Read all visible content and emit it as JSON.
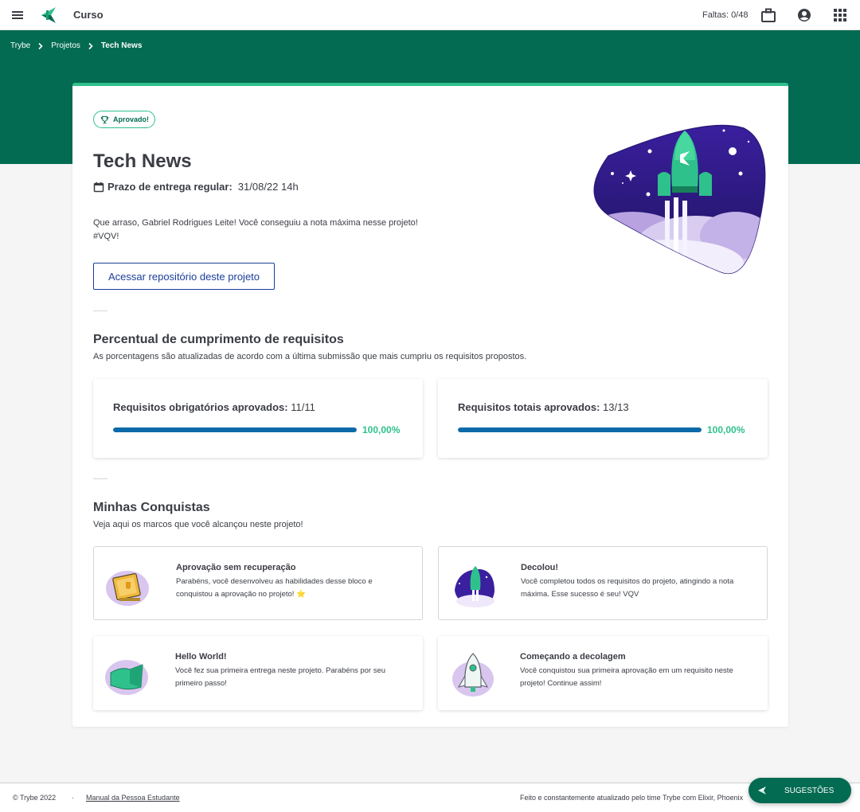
{
  "header": {
    "course_title": "Curso",
    "faltas": "Faltas: 0/48"
  },
  "breadcrumb": [
    "Trybe",
    "Projetos",
    "Tech News"
  ],
  "project": {
    "badge": "Aprovado!",
    "title": "Tech News",
    "deadline_label": "Prazo de entrega regular:",
    "deadline_value": "31/08/22 14h",
    "congrats_line1": "Que arraso, Gabriel Rodrigues Leite! Você conseguiu a nota máxima nesse projeto!",
    "congrats_line2": "#VQV!",
    "repo_button": "Acessar repositório deste projeto"
  },
  "requirements": {
    "title": "Percentual de cumprimento de requisitos",
    "subtitle": "As porcentagens são atualizadas de acordo com a última submissão que mais cumpriu os requisitos propostos.",
    "boxes": [
      {
        "label": "Requisitos obrigatórios aprovados:",
        "value": "11/11",
        "percent_text": "100,00%",
        "fill": 1.0
      },
      {
        "label": "Requisitos totais aprovados:",
        "value": "13/13",
        "percent_text": "100,00%",
        "fill": 1.0
      }
    ]
  },
  "achievements": {
    "title": "Minhas Conquistas",
    "subtitle": "Veja aqui os marcos que você alcançou neste projeto!",
    "items": [
      {
        "title": "Aprovação sem recuperação",
        "desc": "Parabéns, você desenvolveu as habilidades desse bloco e conquistou a aprovação no projeto! ⭐",
        "icon": "trophy-book-icon"
      },
      {
        "title": "Decolou!",
        "desc": "Você completou todos os requisitos do projeto, atingindo a nota máxima. Esse sucesso é seu! VQV",
        "icon": "rocket-launch-icon"
      },
      {
        "title": "Hello World!",
        "desc": "Você fez sua primeira entrega neste projeto. Parabéns por seu primeiro passo!",
        "icon": "flag-icon"
      },
      {
        "title": "Começando a decolagem",
        "desc": "Você conquistou sua primeira aprovação em um requisito neste projeto! Continue assim!",
        "icon": "rocket-icon"
      }
    ]
  },
  "footer": {
    "copyright": "© Trybe 2022",
    "dot": "·",
    "manual": "Manual da Pessoa Estudante",
    "made_by": "Feito e constantemente atualizado pelo time Trybe com Elixir, Phoenix",
    "suggest": "SUGESTÕES"
  },
  "colors": {
    "brand_green": "#036b52",
    "accent_green": "#2fc18c",
    "bar_blue": "#0d6aa8",
    "link_blue": "#1a3e9a"
  }
}
